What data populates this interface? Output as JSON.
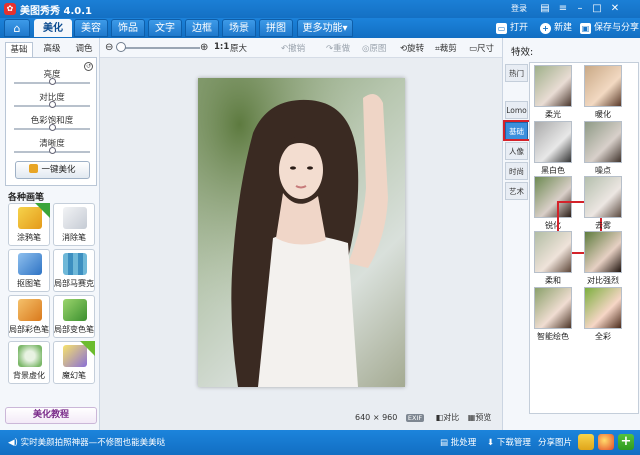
{
  "window": {
    "title": "美图秀秀 4.0.1",
    "login": "登录",
    "icons": [
      "app-icon",
      "window-control"
    ]
  },
  "tabs": [
    "美化",
    "美容",
    "饰品",
    "文字",
    "边框",
    "场景",
    "拼图",
    "更多功能"
  ],
  "tabs_more_arrow": "▾",
  "top_actions": {
    "open": "打开",
    "new": "新建",
    "save_share": "保存与分享"
  },
  "toolbar": {
    "zoom_out": "⊖",
    "zoom_in": "⊕",
    "zoom_label": "1:1",
    "original_size": "原大",
    "undo": "撤销",
    "redo": "重做",
    "original": "原图",
    "rotate": "旋转",
    "crop": "裁剪",
    "size": "尺寸"
  },
  "left_panel": {
    "tabs": [
      "基础",
      "高级",
      "调色"
    ],
    "active_tab": 0,
    "sliders": [
      {
        "label": "亮度",
        "value": 0.5
      },
      {
        "label": "对比度",
        "value": 0.5
      },
      {
        "label": "色彩饱和度",
        "value": 0.5
      },
      {
        "label": "清晰度",
        "value": 0.5
      }
    ],
    "one_key": "一键美化",
    "brushes_title": "各种画笔",
    "brushes": [
      {
        "label": "涂鸦笔",
        "badge": "",
        "color": "#f2b21b"
      },
      {
        "label": "消除笔",
        "badge": "",
        "color": "#d9dde3"
      },
      {
        "label": "抠图笔",
        "badge": "",
        "color": "#3d83d2"
      },
      {
        "label": "局部马赛克",
        "badge": "",
        "color": "#5fb0d3"
      },
      {
        "label": "局部彩色笔",
        "badge": "",
        "color": "#e89a2b"
      },
      {
        "label": "局部变色笔",
        "badge": "",
        "color": "#5aa547"
      },
      {
        "label": "背景虚化",
        "badge": "",
        "color": "#6bab58"
      },
      {
        "label": "魔幻笔",
        "badge": "",
        "color": "#8a6fd6"
      }
    ],
    "tutorial": "美化教程"
  },
  "canvas": {
    "size_w": "640",
    "size_x": "×",
    "size_h": "960",
    "exif": "EXIF",
    "compare": "对比",
    "preview": "预览"
  },
  "right_panel": {
    "title": "特效:",
    "tabs": [
      "热门",
      "基础",
      "Lomo",
      "人像",
      "时尚",
      "艺术"
    ],
    "active_tab": 1,
    "effects": [
      "柔光",
      "暖化",
      "黑白色",
      "噪点",
      "锐化",
      "去雾",
      "柔和",
      "对比强烈",
      "智能绘色",
      "全彩"
    ],
    "selected_effect": 4
  },
  "bottom_bar": {
    "ticker": "实时美颜拍照神器—不修图也能美美哒",
    "batch": "批处理",
    "download": "下载管理",
    "share": "分享图片"
  },
  "colors": {
    "accent": "#1470c4",
    "highlight": "#d4222a"
  }
}
